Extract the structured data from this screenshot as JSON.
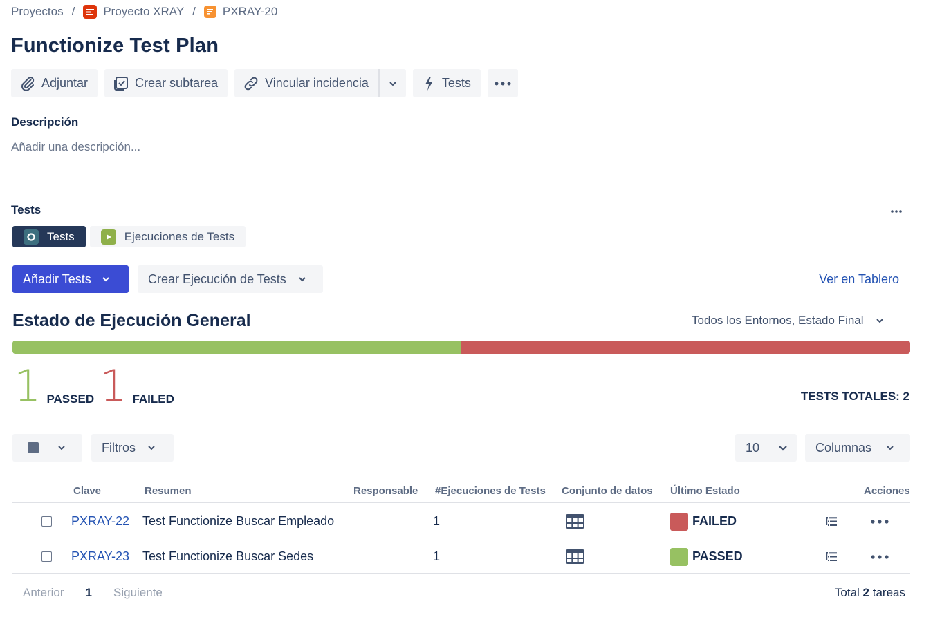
{
  "breadcrumb": {
    "projects": "Proyectos",
    "project": "Proyecto XRAY",
    "issue": "PXRAY-20",
    "separator": "/"
  },
  "title": "Functionize Test Plan",
  "toolbar": {
    "attach": "Adjuntar",
    "subtask": "Crear subtarea",
    "link": "Vincular incidencia",
    "tests": "Tests"
  },
  "description": {
    "label": "Descripción",
    "placeholder": "Añadir una descripción..."
  },
  "tests_section": {
    "label": "Tests",
    "tabs": [
      {
        "label": "Tests",
        "active": true
      },
      {
        "label": "Ejecuciones de Tests",
        "active": false
      }
    ],
    "add_tests": "Añadir Tests",
    "create_execution": "Crear Ejecución de Tests",
    "view_board": "Ver en Tablero"
  },
  "status": {
    "title": "Estado de Ejecución General",
    "environment": "Todos los Entornos, Estado Final",
    "progress": [
      {
        "status": "PASSED",
        "fraction": 0.5,
        "color": "#97c162"
      },
      {
        "status": "FAILED",
        "fraction": 0.5,
        "color": "#c95a5a"
      }
    ],
    "passed_count": "1",
    "passed_label": "PASSED",
    "failed_count": "1",
    "failed_label": "FAILED",
    "total": "TESTS TOTALES: 2"
  },
  "controls": {
    "filters": "Filtros",
    "page_size": "10",
    "columns": "Columnas"
  },
  "table": {
    "headers": {
      "key": "Clave",
      "summary": "Resumen",
      "assignee": "Responsable",
      "executions": "#Ejecuciones de Tests",
      "dataset": "Conjunto de datos",
      "last_status": "Último Estado",
      "actions": "Acciones"
    },
    "rows": [
      {
        "key": "PXRAY-22",
        "summary": "Test Functionize Buscar Empleado",
        "assignee": "",
        "executions": "1",
        "status": "FAILED",
        "status_color": "#c95a5a"
      },
      {
        "key": "PXRAY-23",
        "summary": "Test Functionize Buscar Sedes",
        "assignee": "",
        "executions": "1",
        "status": "PASSED",
        "status_color": "#97c162"
      }
    ]
  },
  "pagination": {
    "prev": "Anterior",
    "current": "1",
    "next": "Siguiente",
    "total_prefix": "Total",
    "total_count": "2",
    "total_suffix": "tareas"
  },
  "colors": {
    "passed": "#97c162",
    "failed": "#c95a5a",
    "primary": "#3b4cd4",
    "link": "#2453b3"
  }
}
